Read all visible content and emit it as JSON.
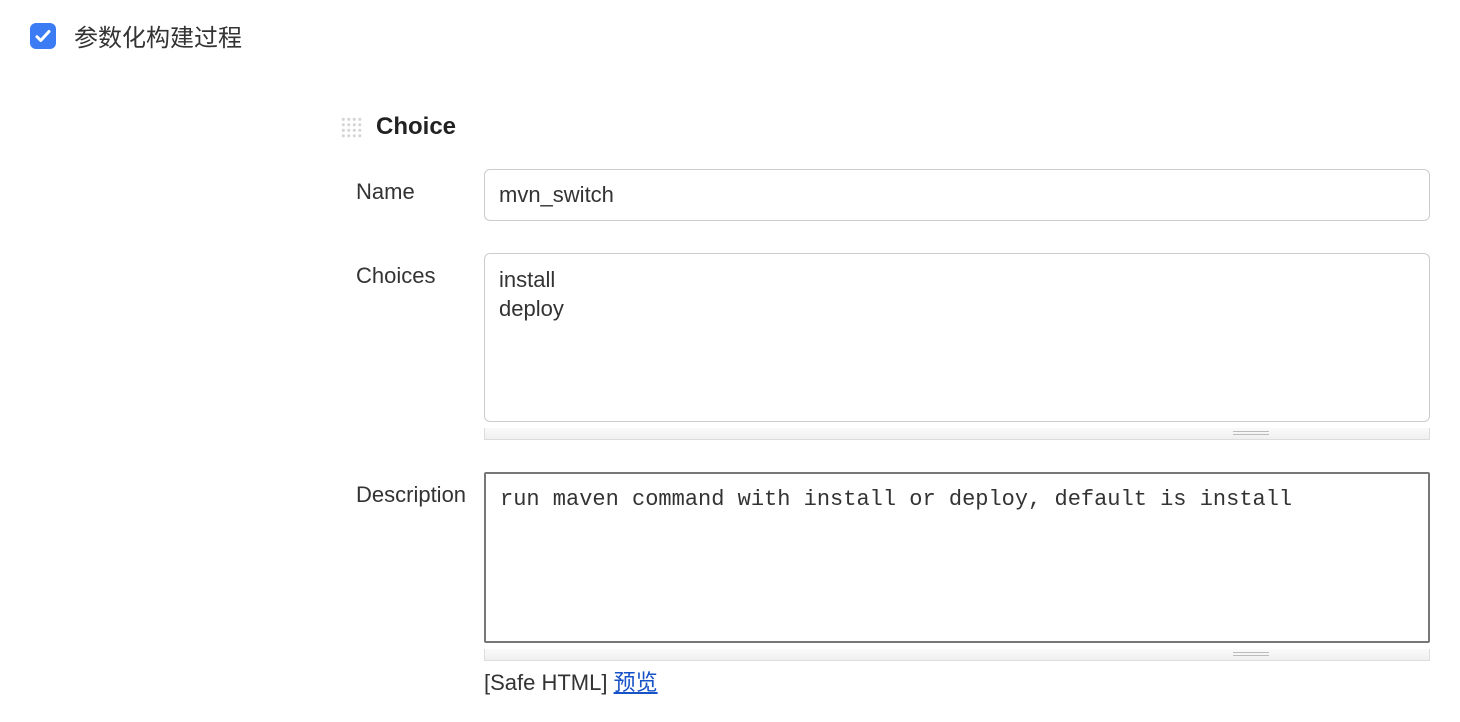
{
  "top": {
    "checkbox_checked": true,
    "label": "参数化构建过程"
  },
  "section": {
    "title": "Choice",
    "fields": {
      "name": {
        "label": "Name",
        "value": "mvn_switch"
      },
      "choices": {
        "label": "Choices",
        "value": "install\ndeploy"
      },
      "description": {
        "label": "Description",
        "value": "run maven command with install or deploy, default is install"
      }
    },
    "footer": {
      "safe_html": "[Safe HTML]",
      "preview": "预览"
    }
  }
}
